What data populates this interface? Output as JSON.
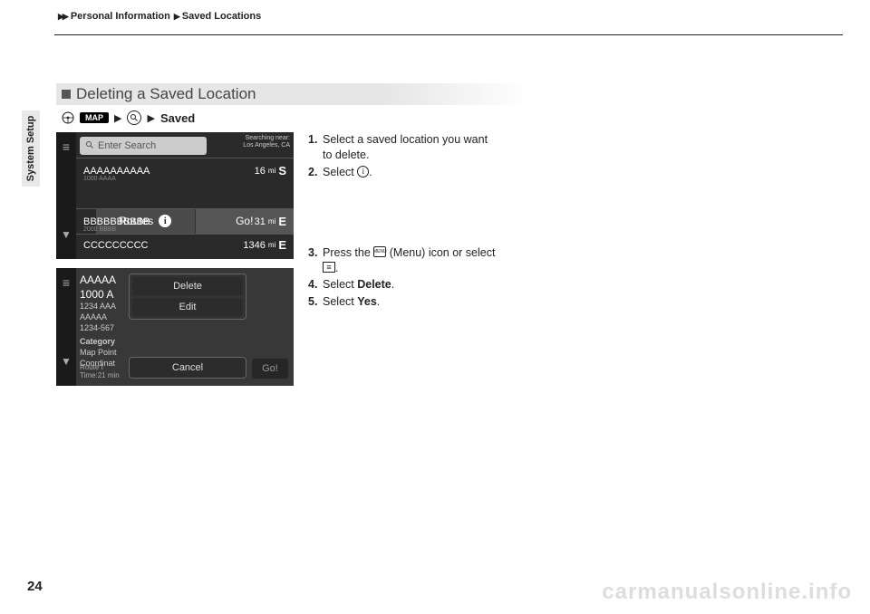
{
  "breadcrumb": {
    "a": "Personal Information",
    "b": "Saved Locations"
  },
  "side_tab": "System Setup",
  "page_num": "24",
  "watermark": "carmanualsonline.info",
  "heading": "Deleting a Saved Location",
  "navseq": {
    "map": "MAP",
    "saved": "Saved"
  },
  "screen1": {
    "search_placeholder": "Enter Search",
    "near_label": "Searching near:",
    "near_value": "Los Angeles, CA",
    "rows": [
      {
        "name": "AAAAAAAAAA",
        "sub": "1000 AAAA",
        "dist": "16",
        "dir": "S"
      },
      {
        "name": "BBBBBBBBBB",
        "sub": "2000 BBBB",
        "dist": "31",
        "dir": "E"
      },
      {
        "name": "CCCCCCCCC",
        "sub": "",
        "dist": "1346",
        "dir": "E"
      }
    ],
    "routes": "Routes",
    "go": "Go!"
  },
  "screen2": {
    "left": {
      "name": "AAAAA",
      "addr": "1000 A",
      "lines": [
        "1234 AAA",
        "AAAAA",
        "1234-567"
      ],
      "cat_label": "Category",
      "cat_val": "Map Point",
      "coord": "Coordinat"
    },
    "popup": {
      "delete": "Delete",
      "edit": "Edit"
    },
    "cancel": "Cancel",
    "go": "Go!",
    "route1": "Route I",
    "route2": "Time:21 min"
  },
  "steps": {
    "s1a": "Select a saved location you want",
    "s1b": "to delete.",
    "s2": "Select ",
    "s3a": "Press the ",
    "s3b": " (Menu) icon or select",
    "s4a": "Select ",
    "s4b": "Delete",
    "s5a": "Select ",
    "s5b": "Yes",
    "menu_label": "MENU"
  }
}
